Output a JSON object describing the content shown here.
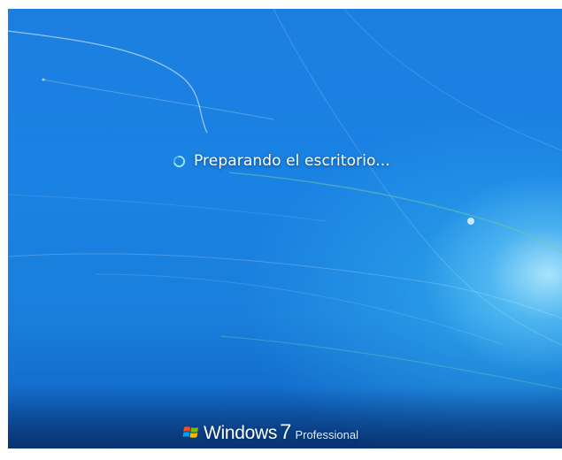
{
  "screen": {
    "status_text": "Preparando el escritorio...",
    "spinner_icon": "loading-spinner-icon"
  },
  "branding": {
    "logo_icon": "windows-flag-icon",
    "name": "Windows",
    "version": "7",
    "edition": "Professional"
  },
  "colors": {
    "background": "#1a82e2",
    "glow": "#bef0ff",
    "text": "#ffffff"
  }
}
